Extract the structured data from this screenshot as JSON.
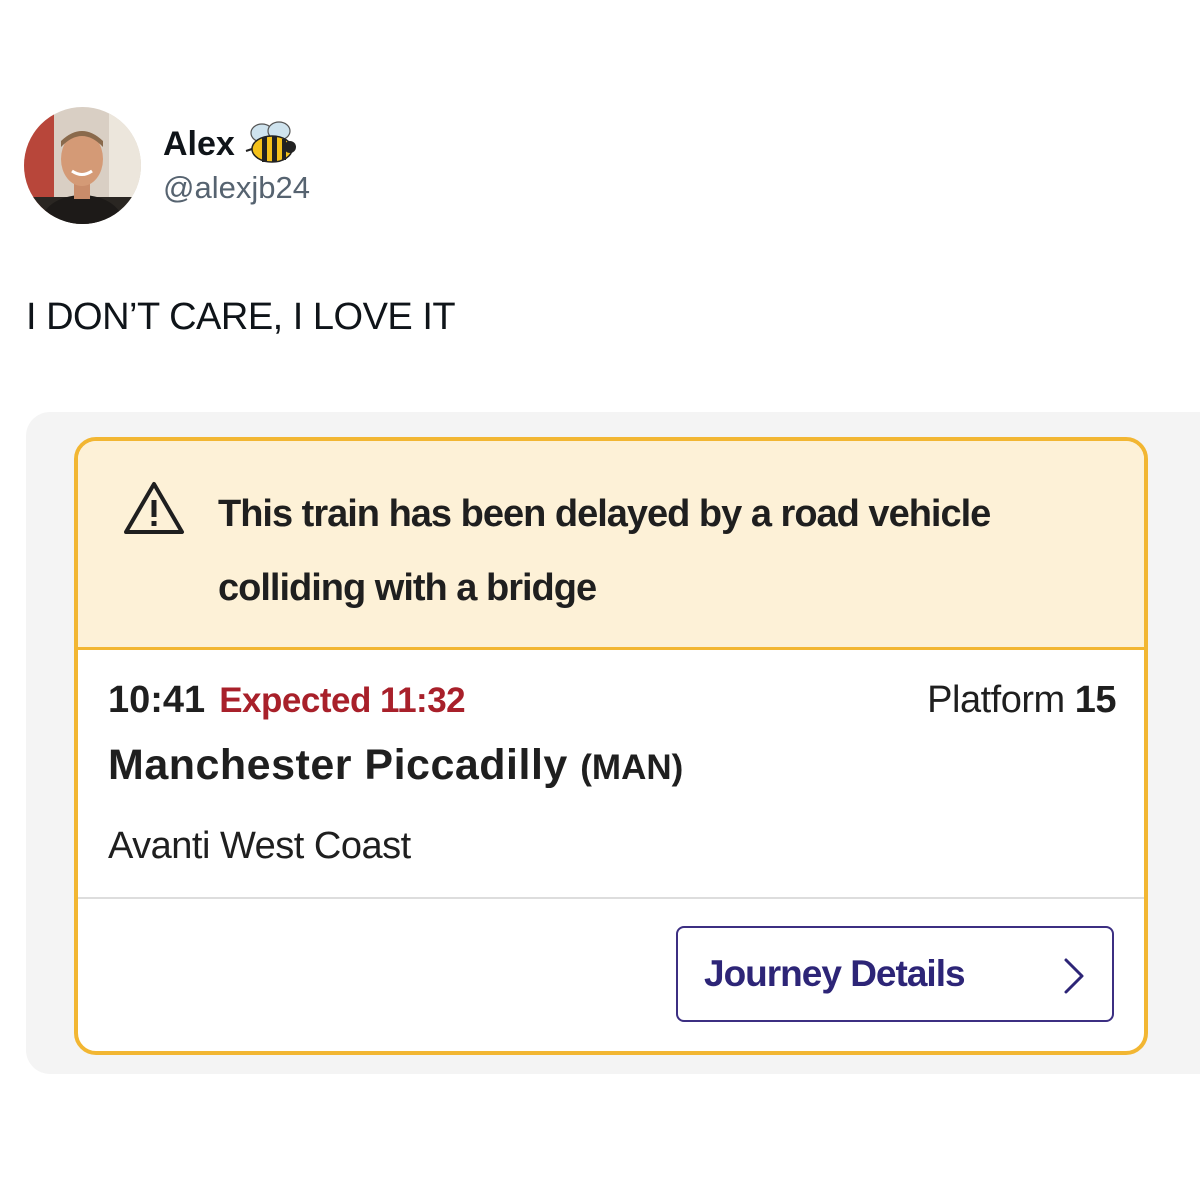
{
  "tweet": {
    "display_name": "Alex",
    "display_name_emoji": "bee-icon",
    "handle": "@alexjb24",
    "text": "I DON’T CARE, I LOVE IT"
  },
  "train_card": {
    "alert_text": "This train has been delayed by a road vehicle colliding with a bridge",
    "alert_icon": "warning-icon",
    "scheduled_time": "10:41",
    "expected_text": "Expected 11:32",
    "platform_label": "Platform",
    "platform_number": "15",
    "station_name": "Manchester Piccadilly",
    "station_code": "(MAN)",
    "operator": "Avanti West Coast",
    "journey_button_label": "Journey Details"
  },
  "colors": {
    "card_border": "#f2b632",
    "alert_background": "#fdf1d7",
    "expected_red": "#a8202a",
    "button_purple": "#2d2577"
  }
}
